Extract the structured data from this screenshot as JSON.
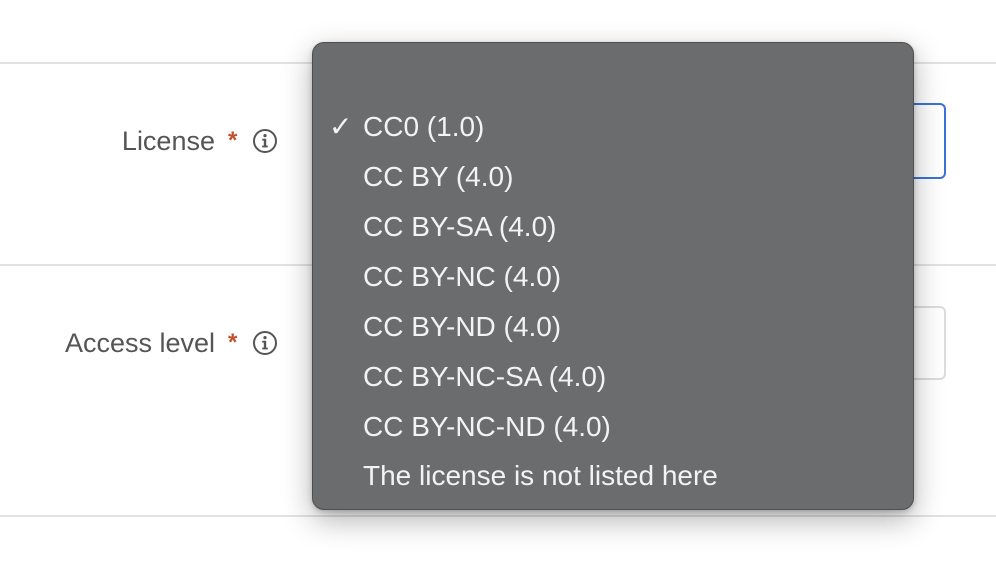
{
  "form": {
    "license": {
      "label": "License",
      "required_mark": "*"
    },
    "access_level": {
      "label": "Access level",
      "required_mark": "*"
    }
  },
  "license_dropdown": {
    "selected_value": "CC0 (1.0)",
    "checkmark": "✓",
    "options": [
      "CC0 (1.0)",
      "CC BY (4.0)",
      "CC BY-SA (4.0)",
      "CC BY-NC (4.0)",
      "CC BY-ND (4.0)",
      "CC BY-NC-SA (4.0)",
      "CC BY-NC-ND (4.0)",
      "The license is not listed here"
    ]
  },
  "colors": {
    "required_asterisk": "#c0522d",
    "focus_border": "#3b73d6",
    "dropdown_background": "#6b6c6d",
    "dropdown_text": "#f3f3f3",
    "label_text": "#555555"
  },
  "icons": {
    "info": "info-circle-icon",
    "selected": "checkmark-icon"
  }
}
